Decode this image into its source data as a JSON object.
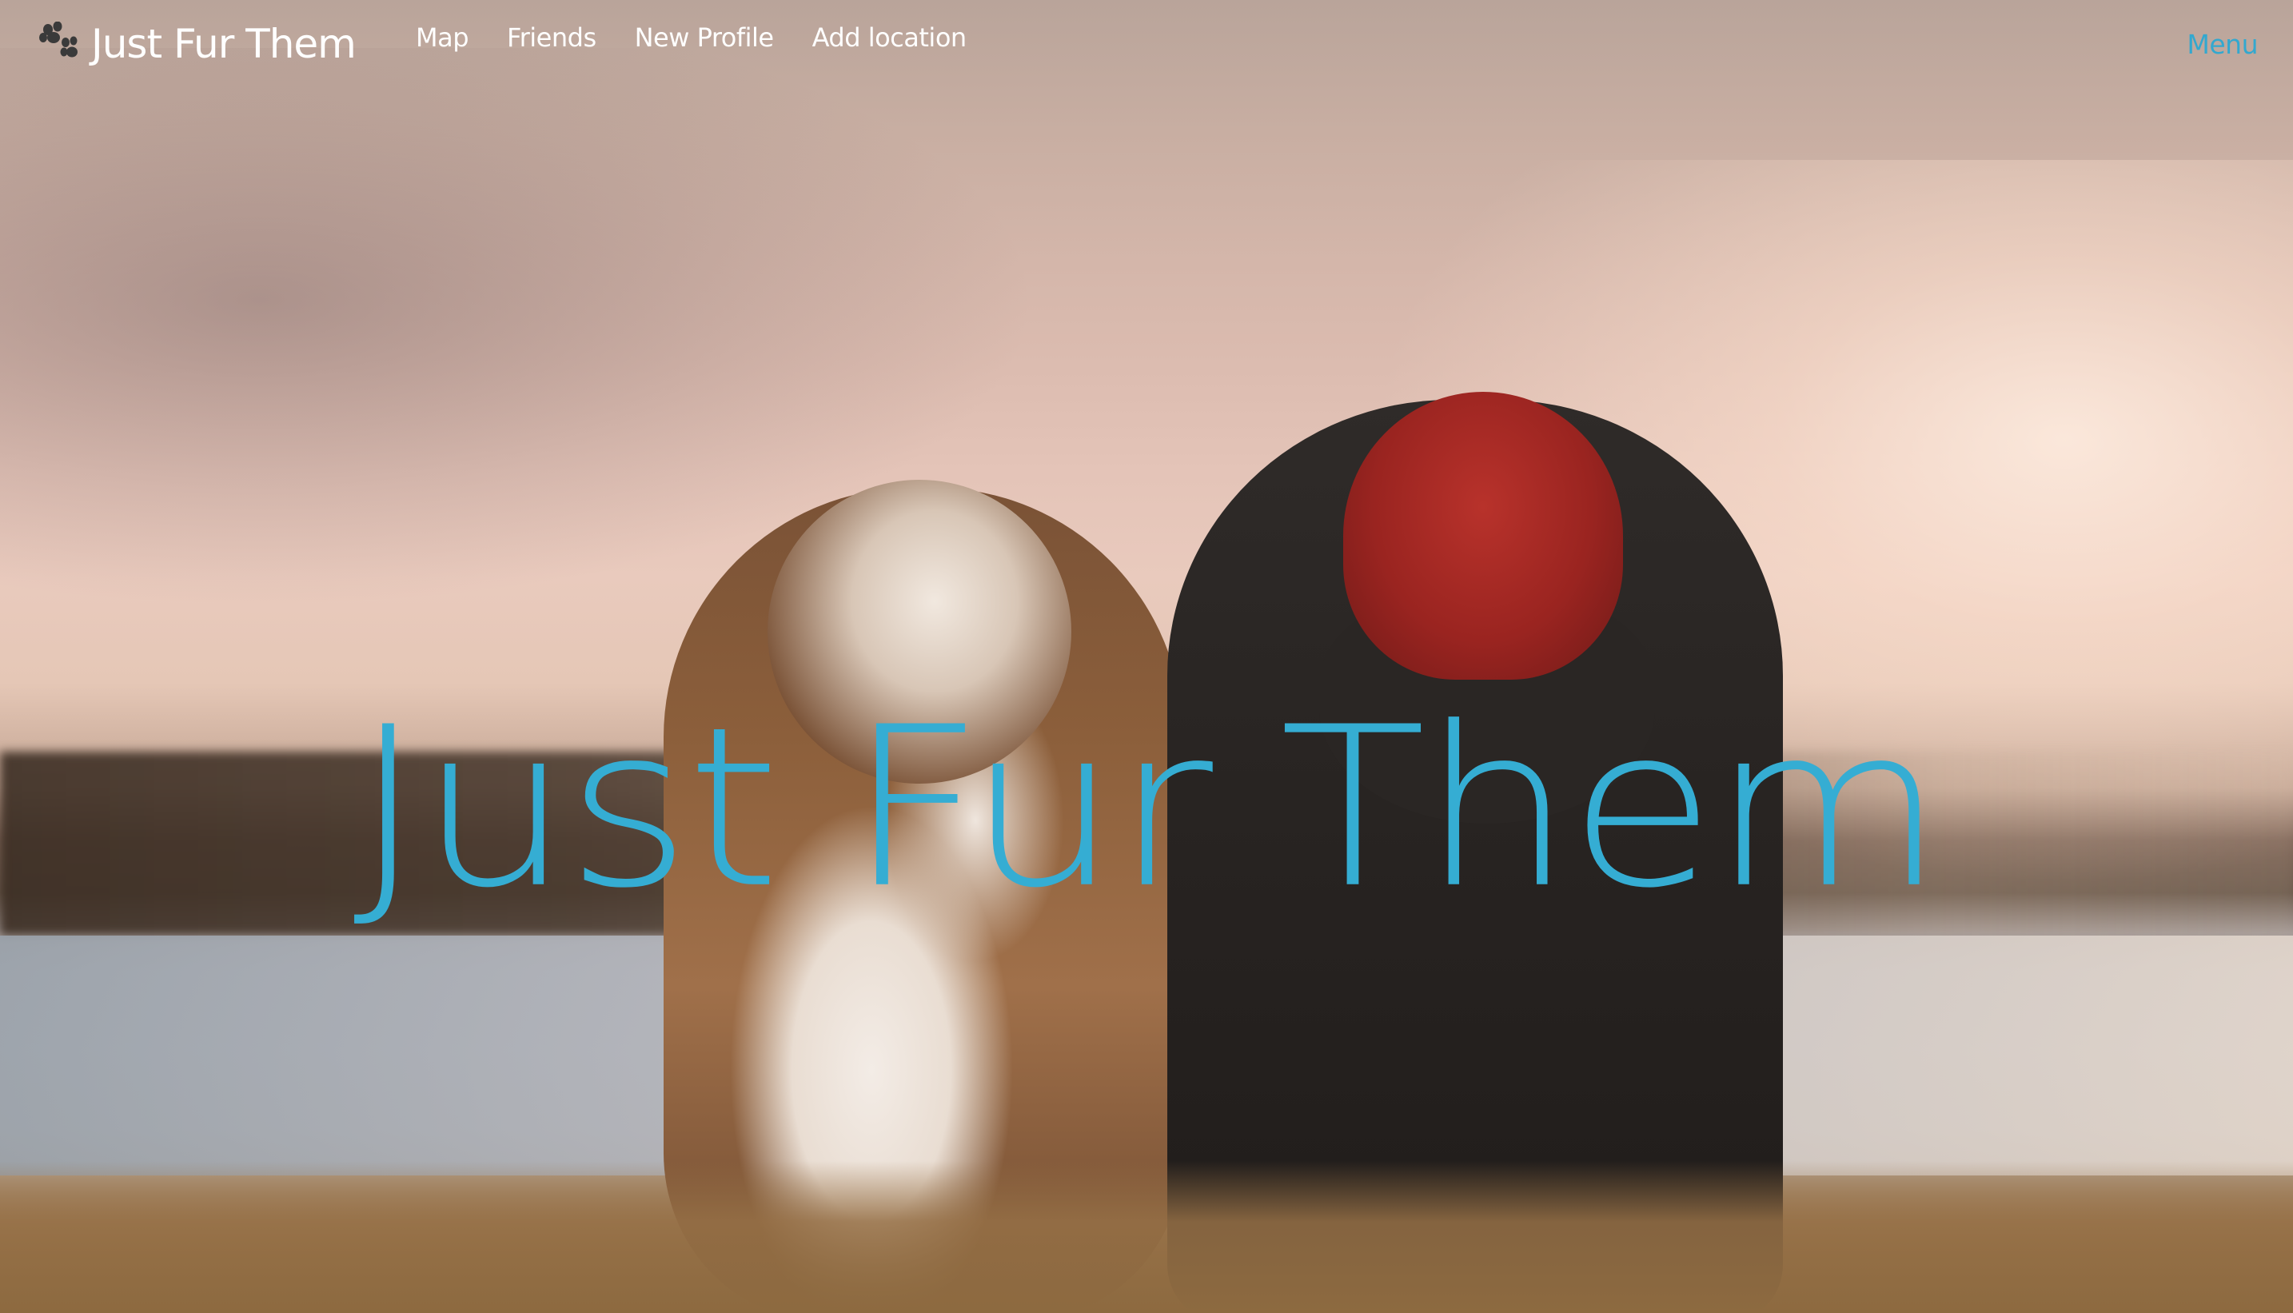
{
  "navbar": {
    "brand": {
      "text": "Just Fur Them",
      "icon": "paw-icon"
    },
    "links": [
      {
        "label": "Map"
      },
      {
        "label": "Friends"
      },
      {
        "label": "New Profile"
      },
      {
        "label": "Add location"
      }
    ],
    "menu_label": "Menu"
  },
  "hero": {
    "title": "Just Fur Them",
    "background_image": "dog-and-woman-by-lake-photo"
  },
  "colors": {
    "accent": "#35add3",
    "nav_text": "#ffffff"
  }
}
